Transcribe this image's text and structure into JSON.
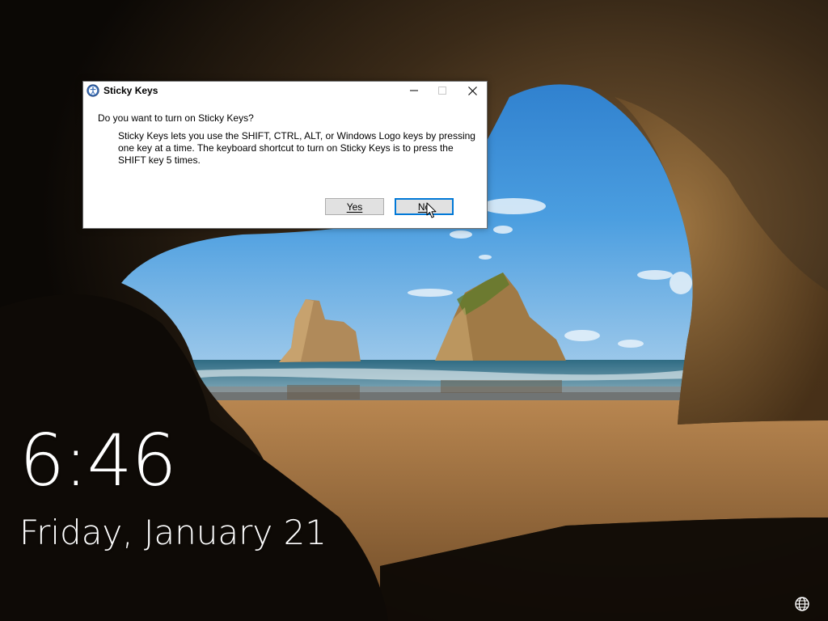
{
  "lock_screen": {
    "time": "6:46",
    "date": "Friday, January 21",
    "language_icon": "globe-icon"
  },
  "dialog": {
    "title": "Sticky Keys",
    "title_icon": "accessibility-icon",
    "question": "Do you want to turn on Sticky Keys?",
    "description": "Sticky Keys lets you use the SHIFT, CTRL, ALT, or Windows Logo keys by pressing one key at a time. The keyboard shortcut to turn on Sticky Keys is to press the SHIFT key 5 times.",
    "buttons": {
      "yes_label": "Yes",
      "no_label": "No"
    },
    "window_controls": [
      "minimize-icon",
      "maximize-icon",
      "close-icon"
    ]
  },
  "colors": {
    "focus_border": "#0078d7",
    "button_face": "#e1e1e1",
    "sky": "#3a8fd6",
    "sand": "#9a6a38"
  }
}
